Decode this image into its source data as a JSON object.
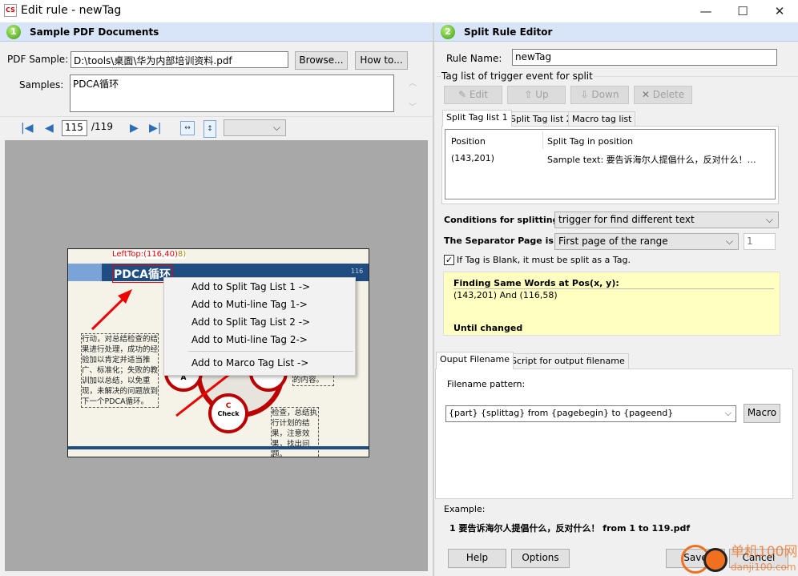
{
  "window": {
    "title": "Edit rule - newTag",
    "icon": "app-icon",
    "controls": [
      "minimize-icon",
      "maximize-icon",
      "close-icon"
    ]
  },
  "left": {
    "header": {
      "step": "1",
      "title": "Sample PDF Documents"
    },
    "pdf_sample_label": "PDF Sample:",
    "pdf_sample_value": "D:\\tools\\桌面\\华为内部培训资料.pdf",
    "browse": "Browse...",
    "howto": "How to...",
    "samples_label": "Samples:",
    "samples_value": "PDCA循环",
    "nav": {
      "page": "115",
      "total": "/119",
      "zoom_value": ""
    },
    "preview": {
      "lefttop_label": "LeftTop:(116,40)",
      "lefttop_suffix": "8)",
      "heading": "PDCA循环",
      "page_marker": "116",
      "text_left": "行动，对总结检查的结果进行处理，成功的经验加以肯定并适当推广、标准化；失败的教训加以总结，以免重现，未解决的问题放到下一个PDCA循环。",
      "text_right1": "实现计划中的内容。",
      "text_right2": "检查，总结执行计划的结果，注意效果，找出问题。",
      "check_letter": "C",
      "check_label": "Check",
      "act_letter": "A"
    },
    "context_menu": [
      "Add to Split Tag List 1 ->",
      "Add to Muti-line Tag  1->",
      "Add to Split Tag List 2 ->",
      "Add to Muti-line Tag  2->",
      "Add to Marco Tag List ->"
    ]
  },
  "right": {
    "header": {
      "step": "2",
      "title": "Split Rule Editor"
    },
    "rule_name_label": "Rule Name:",
    "rule_name_value": "newTag",
    "group_label": "Tag list of trigger event for split",
    "buttons": {
      "edit": "Edit",
      "up": "Up",
      "down": "Down",
      "delete": "Delete"
    },
    "tabs": [
      "Split Tag list 1",
      "Split Tag list 2",
      "Macro tag list"
    ],
    "table": {
      "columns": [
        "Position",
        "Split Tag in position"
      ],
      "rows": [
        [
          "(143,201)",
          "Sample text: 要告诉海尔人提倡什么，反对什么！…"
        ]
      ]
    },
    "conditions_label": "Conditions for splitting:",
    "conditions_value": "trigger for find different text",
    "separator_label": "The Separator Page is:",
    "separator_value": "First page of the range",
    "separator_num": "1",
    "blank_checkbox": {
      "label": "If Tag is Blank, it must be split as a Tag.",
      "checked": true
    },
    "info": {
      "title": "Finding Same Words at Pos(x, y):",
      "positions": "(143,201) And (116,58)",
      "footer": "Until changed"
    },
    "output_tabs": [
      "Ouput Filename",
      "Script for output filename"
    ],
    "filename_label": "Filename pattern:",
    "filename_value": "{part} {splittag} from {pagebegin} to {pageend}",
    "macro": "Macro",
    "example_label": "Example:",
    "example_value": "1 要告诉海尔人提倡什么，反对什么！ from 1 to 119.pdf",
    "help": "Help",
    "options": "Options",
    "save": "Save",
    "cancel": "Cancel"
  },
  "watermark": {
    "text": "单机100网",
    "url_text": "danji100.com"
  },
  "colors": {
    "header_band": "#d8e5f8",
    "info_box": "#ffffc0",
    "preview_bg": "#a8a8a8",
    "slide_blue": "#1f4d82",
    "accent_red": "#e00000"
  }
}
